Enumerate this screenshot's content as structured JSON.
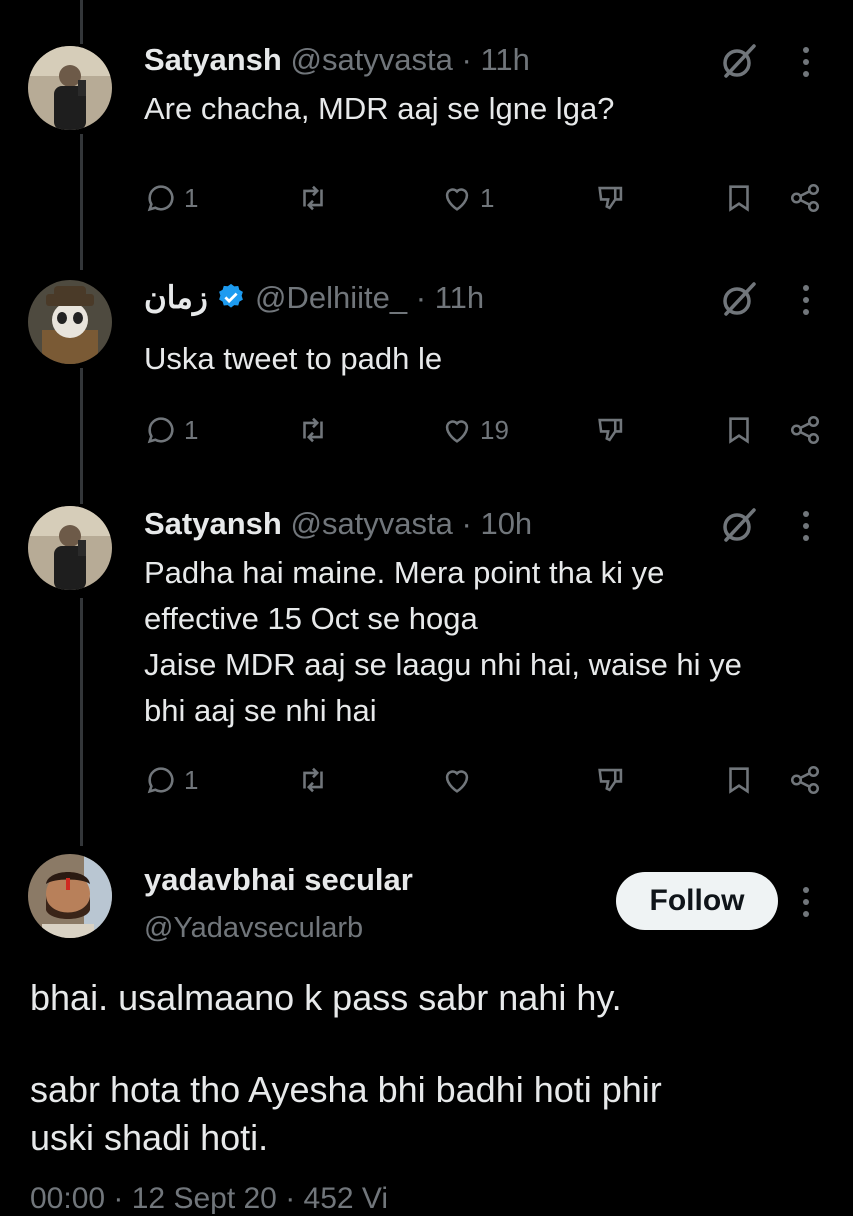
{
  "replies": [
    {
      "name": "Satyansh",
      "handle": "@satyvasta",
      "time": "11h",
      "text": "Are chacha, MDR aaj se lgne lga?",
      "reply_count": "1",
      "retweet_count": "",
      "like_count": "1"
    },
    {
      "name": "زمان",
      "verified": true,
      "handle": "@Delhiite_",
      "time": "11h",
      "text": "Uska tweet to padh le",
      "reply_count": "1",
      "retweet_count": "",
      "like_count": "19"
    },
    {
      "name": "Satyansh",
      "handle": "@satyvasta",
      "time": "10h",
      "text_lines": [
        "Padha hai maine. Mera point tha ki ye",
        "effective 15 Oct se hoga",
        "Jaise MDR aaj se laagu nhi hai, waise hi ye",
        "bhi aaj se nhi hai"
      ],
      "reply_count": "1",
      "retweet_count": "",
      "like_count": ""
    }
  ],
  "main_tweet": {
    "name": "yadavbhai secular",
    "handle": "@Yadavsecularb",
    "follow_label": "Follow",
    "text_line1": "bhai. usalmaano k pass sabr nahi hy.",
    "text_line2": "sabr hota tho Ayesha bhi badhi hoti phir",
    "text_line3": "uski shadi hoti.",
    "meta_partial": "00:00 · 12 Sept 20 · 452 Vi"
  },
  "colors": {
    "background": "#000000",
    "text": "#e7e9ea",
    "muted": "#71767b",
    "verified": "#1d9bf0",
    "thread_line": "#333639"
  },
  "icons": [
    "grok-icon",
    "more-icon",
    "reply-icon",
    "retweet-icon",
    "like-icon",
    "dislike-icon",
    "bookmark-icon",
    "share-icon",
    "verified-badge-icon"
  ]
}
